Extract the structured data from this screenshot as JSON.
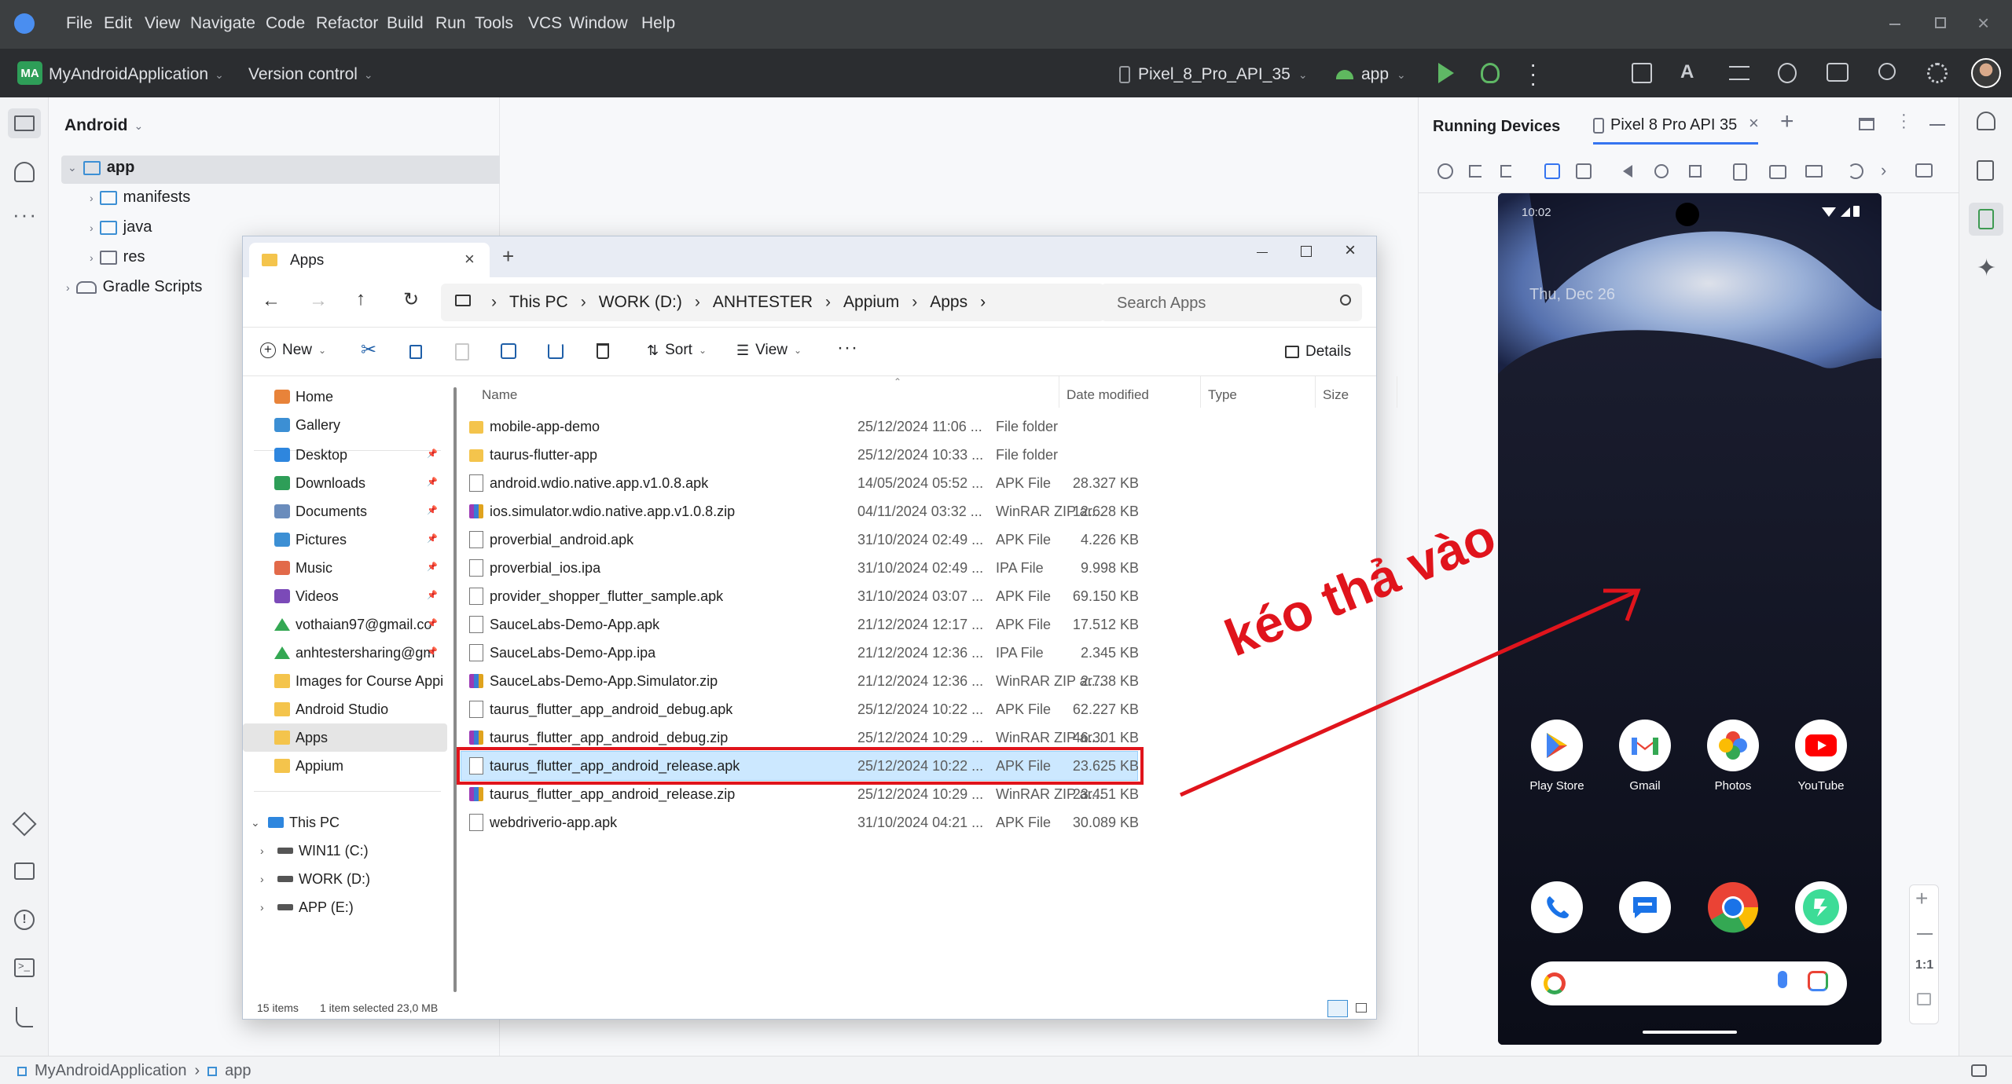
{
  "titlebar": {
    "menu": [
      "File",
      "Edit",
      "View",
      "Navigate",
      "Code",
      "Refactor",
      "Build",
      "Run",
      "Tools",
      "VCS",
      "Window",
      "Help"
    ]
  },
  "toolbar": {
    "project_badge": "MA",
    "project_name": "MyAndroidApplication",
    "version_control": "Version control",
    "device": "Pixel_8_Pro_API_35",
    "run_config": "app"
  },
  "project_panel": {
    "view_mode": "Android",
    "tree": [
      {
        "label": "app",
        "level": 0,
        "expanded": true
      },
      {
        "label": "manifests",
        "level": 1
      },
      {
        "label": "java",
        "level": 1
      },
      {
        "label": "res",
        "level": 1
      },
      {
        "label": "Gradle Scripts",
        "level": 0
      }
    ]
  },
  "running_devices": {
    "title": "Running Devices",
    "tab": "Pixel 8 Pro API 35",
    "phone": {
      "time": "10:02",
      "date": "Thu, Dec 26",
      "apps_row1": [
        "Play Store",
        "Gmail",
        "Photos",
        "YouTube"
      ],
      "zoom_label": "1:1"
    }
  },
  "explorer": {
    "tab_title": "Apps",
    "breadcrumb": [
      "This PC",
      "WORK (D:)",
      "ANHTESTER",
      "Appium",
      "Apps"
    ],
    "search_placeholder": "Search Apps",
    "commands": {
      "new": "New",
      "sort": "Sort",
      "view": "View",
      "details": "Details"
    },
    "nav": {
      "top": [
        "Home",
        "Gallery"
      ],
      "quick": [
        "Desktop",
        "Downloads",
        "Documents",
        "Pictures",
        "Music",
        "Videos",
        "vothaian97@gmail.co",
        "anhtestersharing@gm",
        "Images for Course Appi",
        "Android Studio",
        "Apps",
        "Appium"
      ],
      "this_pc": "This PC",
      "drives": [
        "WIN11 (C:)",
        "WORK (D:)",
        "APP (E:)"
      ]
    },
    "columns": [
      "Name",
      "Date modified",
      "Type",
      "Size"
    ],
    "files": [
      {
        "name": "mobile-app-demo",
        "date": "25/12/2024 11:06 ...",
        "type": "File folder",
        "size": "",
        "icon": "folder"
      },
      {
        "name": "taurus-flutter-app",
        "date": "25/12/2024 10:33 ...",
        "type": "File folder",
        "size": "",
        "icon": "folder"
      },
      {
        "name": "android.wdio.native.app.v1.0.8.apk",
        "date": "14/05/2024 05:52 ...",
        "type": "APK File",
        "size": "28.327 KB",
        "icon": "file"
      },
      {
        "name": "ios.simulator.wdio.native.app.v1.0.8.zip",
        "date": "04/11/2024 03:32 ...",
        "type": "WinRAR ZIP ar...",
        "size": "12.628 KB",
        "icon": "zip"
      },
      {
        "name": "proverbial_android.apk",
        "date": "31/10/2024 02:49 ...",
        "type": "APK File",
        "size": "4.226 KB",
        "icon": "file"
      },
      {
        "name": "proverbial_ios.ipa",
        "date": "31/10/2024 02:49 ...",
        "type": "IPA File",
        "size": "9.998 KB",
        "icon": "file"
      },
      {
        "name": "provider_shopper_flutter_sample.apk",
        "date": "31/10/2024 03:07 ...",
        "type": "APK File",
        "size": "69.150 KB",
        "icon": "file"
      },
      {
        "name": "SauceLabs-Demo-App.apk",
        "date": "21/12/2024 12:17 ...",
        "type": "APK File",
        "size": "17.512 KB",
        "icon": "file"
      },
      {
        "name": "SauceLabs-Demo-App.ipa",
        "date": "21/12/2024 12:36 ...",
        "type": "IPA File",
        "size": "2.345 KB",
        "icon": "file"
      },
      {
        "name": "SauceLabs-Demo-App.Simulator.zip",
        "date": "21/12/2024 12:36 ...",
        "type": "WinRAR ZIP ar...",
        "size": "2.738 KB",
        "icon": "zip"
      },
      {
        "name": "taurus_flutter_app_android_debug.apk",
        "date": "25/12/2024 10:22 ...",
        "type": "APK File",
        "size": "62.227 KB",
        "icon": "file"
      },
      {
        "name": "taurus_flutter_app_android_debug.zip",
        "date": "25/12/2024 10:29 ...",
        "type": "WinRAR ZIP ar...",
        "size": "46.301 KB",
        "icon": "zip"
      },
      {
        "name": "taurus_flutter_app_android_release.apk",
        "date": "25/12/2024 10:22 ...",
        "type": "APK File",
        "size": "23.625 KB",
        "icon": "file",
        "selected": true
      },
      {
        "name": "taurus_flutter_app_android_release.zip",
        "date": "25/12/2024 10:29 ...",
        "type": "WinRAR ZIP ar...",
        "size": "23.451 KB",
        "icon": "zip"
      },
      {
        "name": "webdriverio-app.apk",
        "date": "31/10/2024 04:21 ...",
        "type": "APK File",
        "size": "30.089 KB",
        "icon": "file"
      }
    ],
    "status": {
      "items": "15 items",
      "selected": "1 item selected  23,0 MB"
    }
  },
  "annotation": {
    "text": "kéo thả vào",
    "color": "#e0141c"
  },
  "statusbar": {
    "crumbs": [
      "MyAndroidApplication",
      "app"
    ]
  },
  "colors": {
    "selection": "#cce8ff",
    "ide_dark": "#2b2d30",
    "accent": "#3574f0"
  }
}
